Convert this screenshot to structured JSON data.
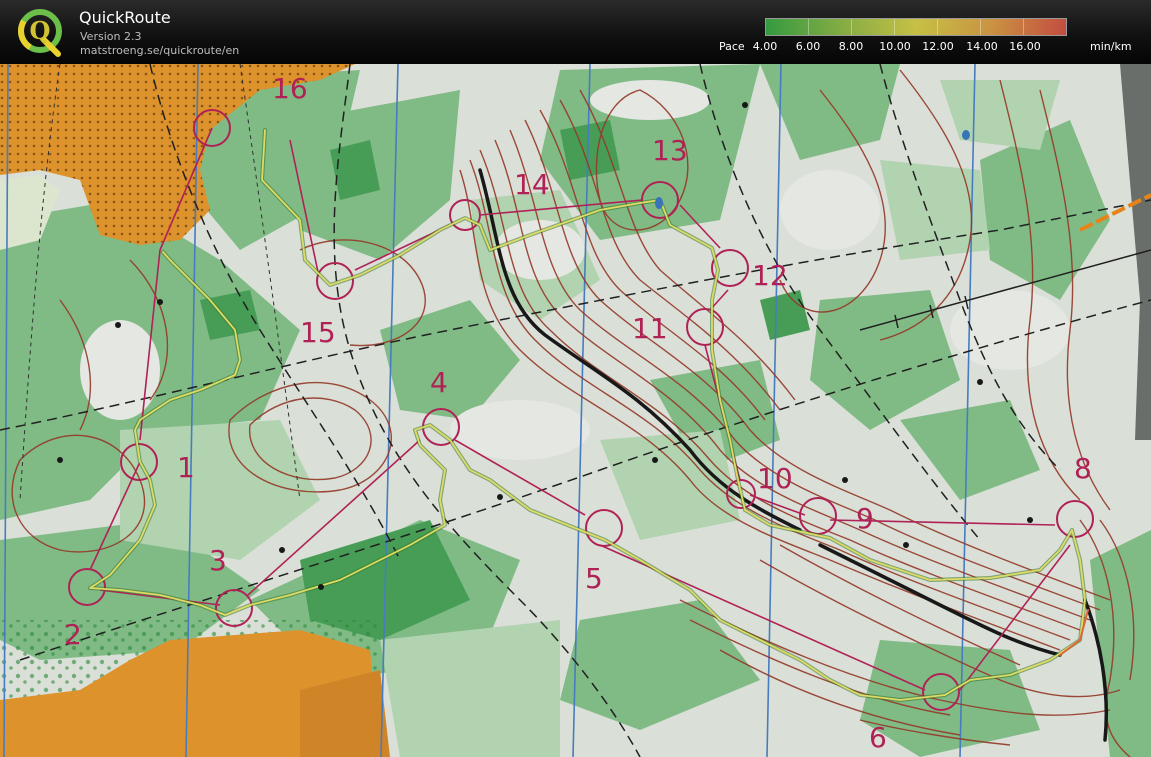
{
  "app": {
    "title": "QuickRoute",
    "version": "Version 2.3",
    "url": "matstroeng.se/quickroute/en",
    "logo_letter": "Q"
  },
  "legend": {
    "label": "Pace",
    "ticks": [
      "4.00",
      "6.00",
      "8.00",
      "10.00",
      "12.00",
      "14.00",
      "16.00"
    ],
    "unit": "min/km",
    "gradient_colors": [
      "#3dbb4a",
      "#9ed14f",
      "#f2ea50",
      "#f6b24c",
      "#ef5a4c"
    ]
  },
  "map": {
    "controls": [
      {
        "number": "1"
      },
      {
        "number": "2"
      },
      {
        "number": "3"
      },
      {
        "number": "4"
      },
      {
        "number": "5"
      },
      {
        "number": "6"
      },
      {
        "number": "8"
      },
      {
        "number": "9"
      },
      {
        "number": "10"
      },
      {
        "number": "11"
      },
      {
        "number": "12"
      },
      {
        "number": "13"
      },
      {
        "number": "14"
      },
      {
        "number": "15"
      },
      {
        "number": "16"
      }
    ],
    "colors": {
      "forest_green": "#7fbf86",
      "light_green": "#b6dcb5",
      "open_land": "#e99a2e",
      "paper": "#e9ece6",
      "contour": "#9a3b2a",
      "course": "#b8245a",
      "magnetic_north": "#4a82c8",
      "route": "#f2ea50"
    }
  }
}
